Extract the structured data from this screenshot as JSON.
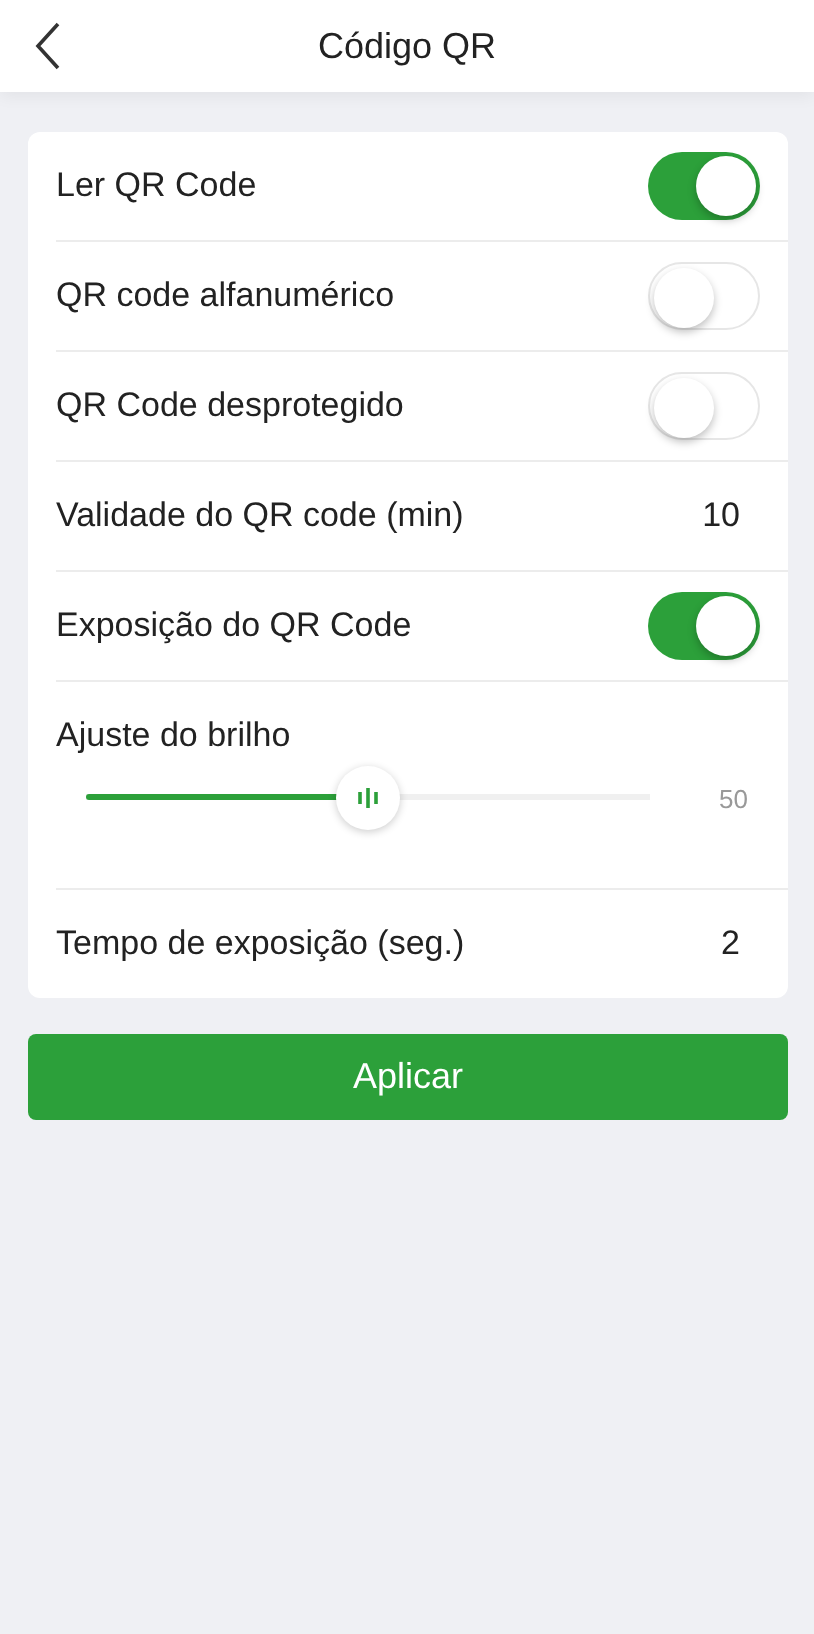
{
  "header": {
    "title": "Código QR"
  },
  "settings": [
    {
      "kind": "toggle",
      "label": "Ler QR Code",
      "on": true
    },
    {
      "kind": "toggle",
      "label": "QR code alfanumérico",
      "on": false
    },
    {
      "kind": "toggle",
      "label": "QR Code desprotegido",
      "on": false
    },
    {
      "kind": "value",
      "label": "Validade do QR code (min)",
      "value": "10"
    },
    {
      "kind": "toggle",
      "label": "Exposição do QR Code",
      "on": true
    },
    {
      "kind": "slider",
      "label": "Ajuste do brilho",
      "level": 0.5,
      "reading": "50"
    },
    {
      "kind": "value",
      "label": "Tempo de exposição (seg.)",
      "value": "2"
    }
  ],
  "apply_button": "Aplicar"
}
